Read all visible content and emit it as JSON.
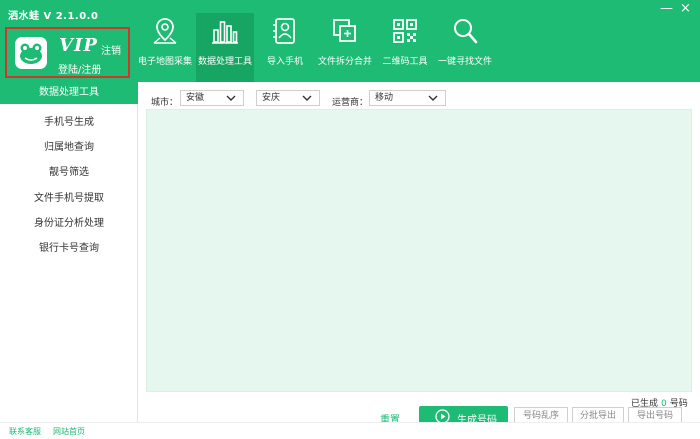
{
  "app": {
    "title": "洒水蛙  V 2.1.0.0"
  },
  "window": {
    "minimize_glyph": "—",
    "close_glyph": "×"
  },
  "vip": {
    "badge": "VIP",
    "logout": "注销",
    "login": "登陆/注册"
  },
  "toolbar": {
    "active": "数据处理工具",
    "items": [
      {
        "label": "电子地图采集",
        "icon": "map-pin-icon"
      },
      {
        "label": "数据处理工具",
        "icon": "bar-chart-icon"
      },
      {
        "label": "导入手机",
        "icon": "contact-card-icon"
      },
      {
        "label": "文件拆分合并",
        "icon": "file-merge-icon"
      },
      {
        "label": "二维码工具",
        "icon": "qr-code-icon"
      },
      {
        "label": "一键寻找文件",
        "icon": "search-icon"
      }
    ]
  },
  "sidebar": {
    "header": "数据处理工具",
    "items": [
      {
        "label": "手机号生成"
      },
      {
        "label": "归属地查询"
      },
      {
        "label": "靓号筛选"
      },
      {
        "label": "文件手机号提取"
      },
      {
        "label": "身份证分析处理"
      },
      {
        "label": "银行卡号查询"
      }
    ]
  },
  "filters": {
    "city_label": "城市：",
    "province": "安徽",
    "city": "安庆",
    "carrier_label": "运营商：",
    "carrier": "移动"
  },
  "status": {
    "generated_prefix": "已生成",
    "generated_count": "0",
    "generated_suffix": "号码"
  },
  "actions": {
    "reset": "重置",
    "generate": "生成号码",
    "shuffle": "号码乱序",
    "batch_export": "分批导出",
    "export": "导出号码"
  },
  "footer": {
    "contact": "联系客服",
    "website": "网站首页"
  },
  "colors": {
    "brand": "#1dbb74",
    "brand_dark": "#17a563",
    "content_bg": "#e6f7ef",
    "highlight_border": "#c9392c"
  }
}
